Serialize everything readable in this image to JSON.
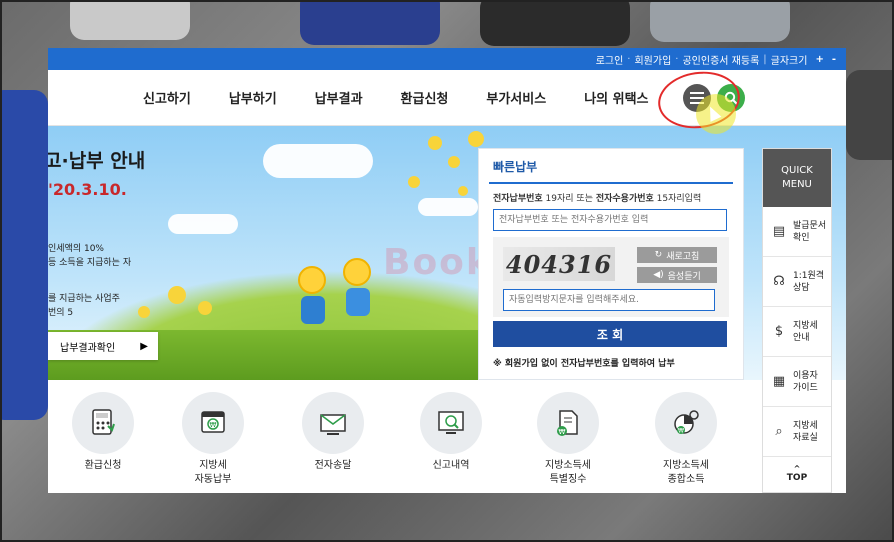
{
  "topbar": {
    "links": [
      "로그인",
      "회원가입",
      "공인인증서 재등록"
    ],
    "font_size_label": "글자크기",
    "plus": "+",
    "minus": "-"
  },
  "nav": {
    "items": [
      "신고하기",
      "납부하기",
      "납부결과",
      "환급신청",
      "부가서비스",
      "나의 위택스"
    ],
    "hamburger_icon": "hamburger-icon",
    "search_icon": "search-icon"
  },
  "hero": {
    "title": "고·납부 안내",
    "date": "'20.3.10.",
    "text1": "인세액의 10%",
    "text2": "등 소득을 지급하는 자",
    "text3": "를 지급하는 사업주",
    "text4": "번의 5",
    "result_button": "납부결과확인",
    "result_arrow": "▶",
    "watermark": "Book"
  },
  "quick_pay": {
    "title": "빠른납부",
    "desc_bold1": "전자납부번호",
    "desc_mid": " 19자리 또는 ",
    "desc_bold2": "전자수용가번호",
    "desc_end": " 15자리입력",
    "input_placeholder": "전자납부번호 또는 전자수용가번호 입력",
    "captcha_text": "404316",
    "refresh_label": "새로고침",
    "audio_label": "음성듣기",
    "captcha_placeholder": "자동입력방지문자를 입력해주세요.",
    "submit_label": "조 회",
    "note": "※ 회원가입 없이 전자납부번호를 입력하여 납부"
  },
  "services": [
    {
      "label1": "환급신청",
      "label2": "",
      "icon": "refund-calculator-icon"
    },
    {
      "label1": "지방세",
      "label2": "자동납부",
      "icon": "auto-payment-icon"
    },
    {
      "label1": "전자송달",
      "label2": "",
      "icon": "e-delivery-icon"
    },
    {
      "label1": "신고내역",
      "label2": "",
      "icon": "report-history-icon"
    },
    {
      "label1": "지방소득세",
      "label2": "특별징수",
      "icon": "special-withholding-icon"
    },
    {
      "label1": "지방소득세",
      "label2": "종합소득",
      "icon": "comprehensive-income-icon"
    }
  ],
  "quick_menu": {
    "title1": "QUICK",
    "title2": "MENU",
    "items": [
      {
        "label1": "발급문서",
        "label2": "확인",
        "icon": "document-icon"
      },
      {
        "label1": "1:1원격",
        "label2": "상담",
        "icon": "headset-icon"
      },
      {
        "label1": "지방세",
        "label2": "안내",
        "icon": "money-bag-icon"
      },
      {
        "label1": "이용자",
        "label2": "가이드",
        "icon": "guide-icon"
      },
      {
        "label1": "지방세",
        "label2": "자료실",
        "icon": "archive-icon"
      }
    ],
    "top_label": "TOP",
    "top_arrow": "^"
  }
}
